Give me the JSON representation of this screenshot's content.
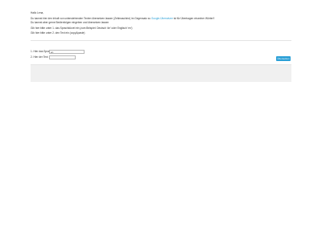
{
  "message": {
    "greeting": "Hallo Lena,",
    "intro_before": "Du kannst hier den Inhalt von untenstehenden Texten übersetzen lassen (Zeitmaschine) im Gegensatz zu",
    "intro_link": "Google-Übersetzer",
    "intro_after": "ist für Übertragen einzelner Wörter!!",
    "note": "Du kannst aber gerne Bedienfolgen eingeben und übersetzen lassen",
    "hint1": "Gib hier bitte unter 1. das Sprachkürzel ein (zum Beispiel: Deutsch 'de' oder Englisch 'en')",
    "hint2": "Gib hier bitte unter 2. den Text ein (copy&paste)"
  },
  "form": {
    "language_label": "1. Hier das Sprachkürzel",
    "language_value": "en",
    "text_label": "2. Hier der Text",
    "text_value": "",
    "submit_label": "Übersetzen"
  }
}
